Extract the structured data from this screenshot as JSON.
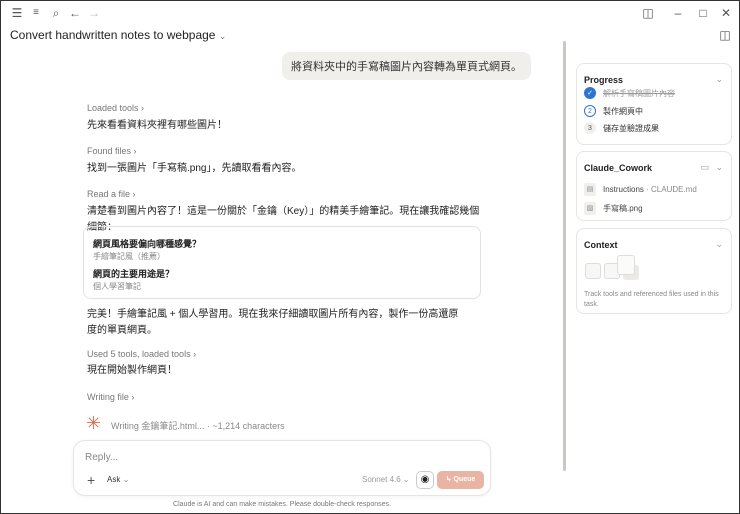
{
  "window": {
    "title": "Convert handwritten notes to webpage"
  },
  "chat": {
    "user_message": "將資料夾中的手寫稿圖片內容轉為單頁式網頁。",
    "steps": [
      {
        "label": "Loaded tools",
        "text": "先來看看資料夾裡有哪些圖片！"
      },
      {
        "label": "Found files",
        "text": "找到一張圖片「手寫稿.png」，先讀取看看內容。"
      },
      {
        "label": "Read a file",
        "text": "清楚看到圖片內容了！這是一份關於「金鑰（Key）」的精美手繪筆記。現在讓我確認幾個細節："
      }
    ],
    "questions": [
      {
        "q": "網頁風格要偏向哪種感覺？",
        "a": "手繪筆記風（推薦）"
      },
      {
        "q": "網頁的主要用途是？",
        "a": "個人學習筆記"
      }
    ],
    "after_text": "完美！手繪筆記風 + 個人學習用。現在我來仔細讀取圖片所有內容，製作一份高還原度的單頁網頁。",
    "used_tools_label": "Used 5 tools, loaded tools",
    "start_text": "現在開始製作網頁！",
    "writing_label": "Writing file",
    "writing_status": "Writing 金鑰筆記.html...",
    "writing_chars": "~1,214 characters"
  },
  "composer": {
    "placeholder": "Reply...",
    "mode": "Ask",
    "model": "Sonnet 4.6",
    "queue": "Queue"
  },
  "disclaimer": "Claude is AI and can make mistakes. Please double-check responses.",
  "progress": {
    "title": "Progress",
    "items": [
      {
        "n": "✓",
        "label": "解析手寫稿圖片內容",
        "state": "done"
      },
      {
        "n": "2",
        "label": "製作網頁中",
        "state": "active"
      },
      {
        "n": "3",
        "label": "儲存並驗證成果",
        "state": "pending"
      }
    ]
  },
  "folder": {
    "title": "Claude_Cowork",
    "files": [
      {
        "name": "Instructions",
        "suffix": " · CLAUDE.md"
      },
      {
        "name": "手寫稿.png",
        "suffix": ""
      }
    ]
  },
  "context": {
    "title": "Context",
    "desc": "Track tools and referenced files used in this task."
  },
  "colors": {
    "accent": "#e06b4b",
    "queue": "#e9b4a3",
    "check": "#2f74d0"
  }
}
